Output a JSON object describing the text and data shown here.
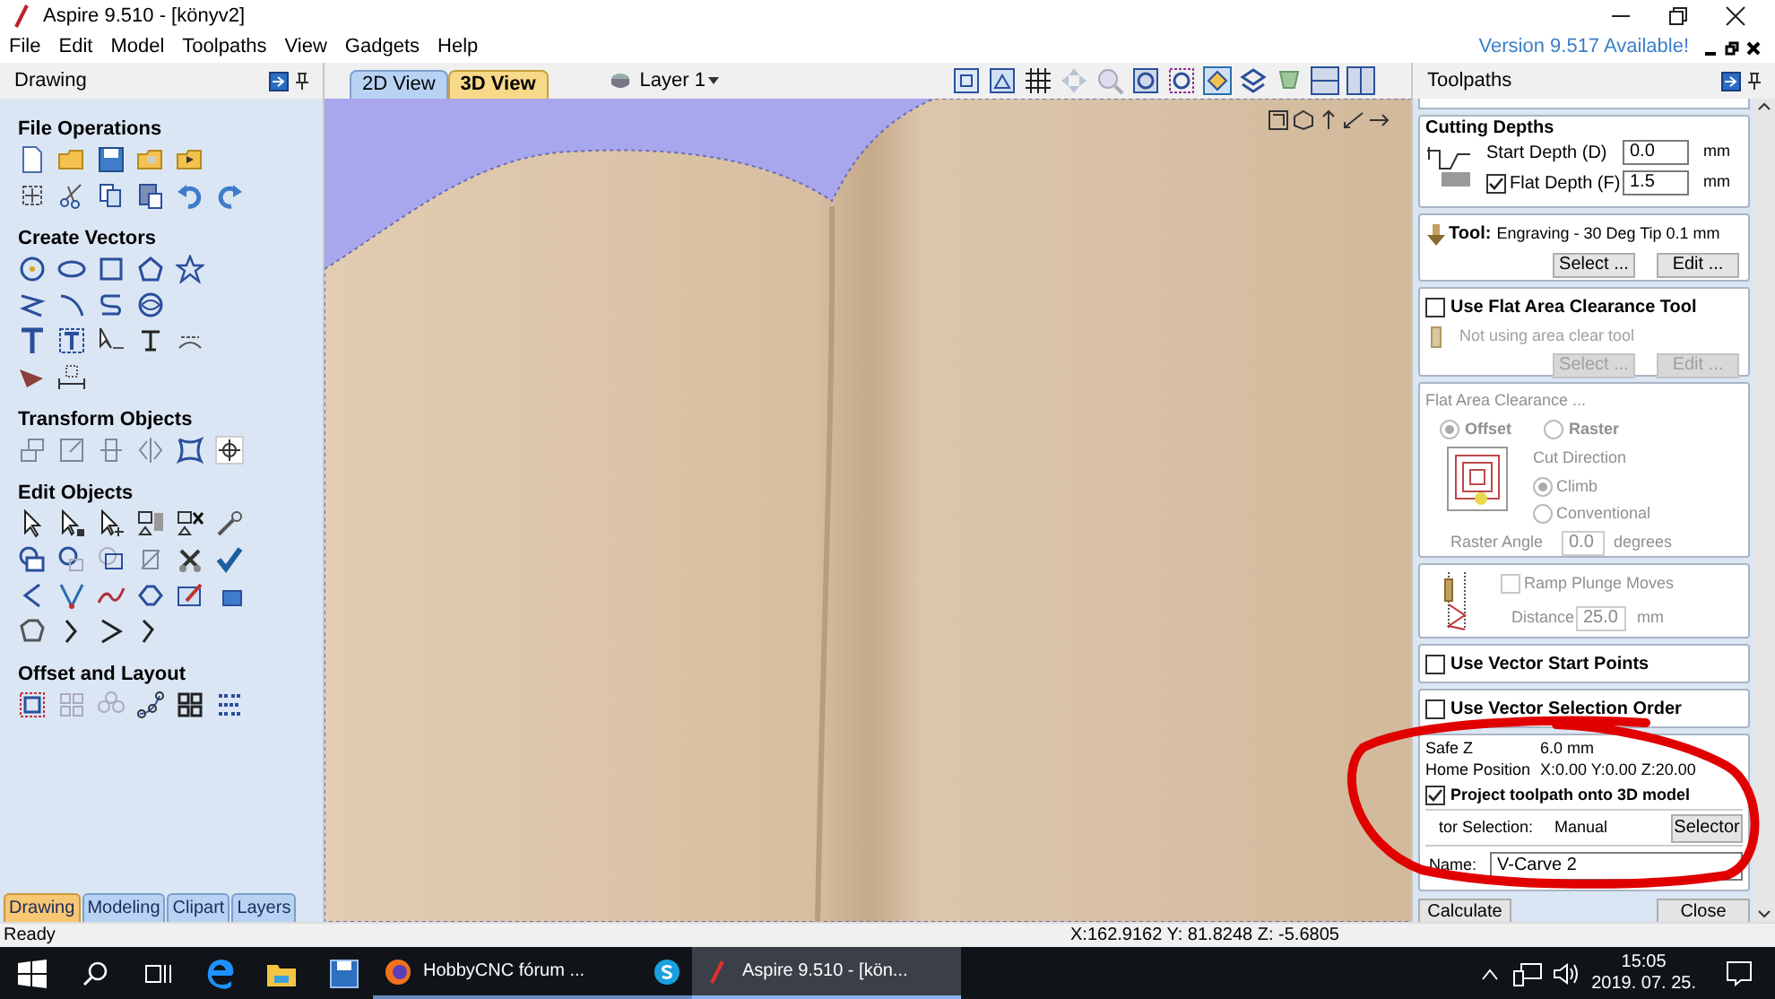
{
  "window": {
    "title": "Aspire 9.510 - [könyv2]"
  },
  "menu": [
    "File",
    "Edit",
    "Model",
    "Toolpaths",
    "View",
    "Gadgets",
    "Help"
  ],
  "update_notice": "Version 9.517 Available!",
  "left_panel": {
    "title": "Drawing",
    "sections": [
      {
        "title": "File Operations"
      },
      {
        "title": "Create Vectors"
      },
      {
        "title": "Transform Objects"
      },
      {
        "title": "Edit Objects"
      },
      {
        "title": "Offset and Layout"
      }
    ],
    "tabs": [
      {
        "label": "Drawing",
        "selected": true
      },
      {
        "label": "Modeling",
        "selected": false
      },
      {
        "label": "Clipart",
        "selected": false
      },
      {
        "label": "Layers",
        "selected": false
      }
    ]
  },
  "view_tabs": [
    {
      "label": "2D View",
      "selected": false
    },
    {
      "label": "3D View",
      "selected": true
    }
  ],
  "layer": "Layer 1",
  "toolpaths": {
    "title": "Toolpaths",
    "cutting_depths": {
      "title": "Cutting Depths",
      "start_label": "Start Depth (D)",
      "start": "0.0",
      "start_unit": "mm",
      "flat_checked": true,
      "flat_label": "Flat Depth (F)",
      "flat": "1.5",
      "flat_unit": "mm"
    },
    "tool": {
      "label": "Tool:",
      "name": "Engraving - 30 Deg Tip 0.1 mm",
      "buttons": [
        "Select ...",
        "Edit ..."
      ]
    },
    "flat_tool": {
      "label": "Use Flat Area Clearance Tool",
      "checked": false,
      "status": "Not using area clear tool",
      "disabled": true,
      "buttons": [
        "Select ...",
        "Edit ..."
      ]
    },
    "flat_clearance": {
      "title": "Flat Area Clearance ...",
      "disabled": true,
      "strategies": [
        {
          "label": "Offset",
          "selected": true
        },
        {
          "label": "Raster",
          "selected": false
        }
      ],
      "cut_direction_label": "Cut Direction",
      "directions": [
        {
          "label": "Climb",
          "selected": true
        },
        {
          "label": "Conventional",
          "selected": false
        }
      ],
      "angle_label": "Raster Angle",
      "angle": "0.0",
      "angle_unit": "degrees"
    },
    "ramp": {
      "label": "Ramp Plunge Moves",
      "checked": false,
      "disabled": true,
      "distance_label": "Distance",
      "distance": "25.0",
      "distance_unit": "mm"
    },
    "options": [
      {
        "label": "Use Vector Start Points",
        "checked": false
      },
      {
        "label": "Use Vector Selection Order",
        "checked": false
      }
    ],
    "safe_z_label": "Safe Z",
    "safe_z": "6.0 mm",
    "home_label": "Home Position",
    "home": "X:0.00 Y:0.00 Z:20.00",
    "project": {
      "label": "Project toolpath onto 3D model",
      "checked": true
    },
    "selection_label": "tor Selection:",
    "selection": "Manual",
    "selector_button": "Selector",
    "name_label": "Name:",
    "name": "V-Carve 2",
    "calculate": "Calculate",
    "close": "Close"
  },
  "status_bar": {
    "text": "Ready",
    "coordinates": "X:162.9162 Y: 81.8248 Z: -5.6805"
  },
  "taskbar": {
    "apps": [
      {
        "kind": "firefox",
        "label": "HobbyCNC fórum ...",
        "selected": false
      },
      {
        "kind": "skype",
        "selected": false
      },
      {
        "kind": "aspire",
        "label": "Aspire 9.510 - [kön...",
        "selected": true
      }
    ],
    "time": "15:05",
    "date": "2019. 07. 25."
  }
}
